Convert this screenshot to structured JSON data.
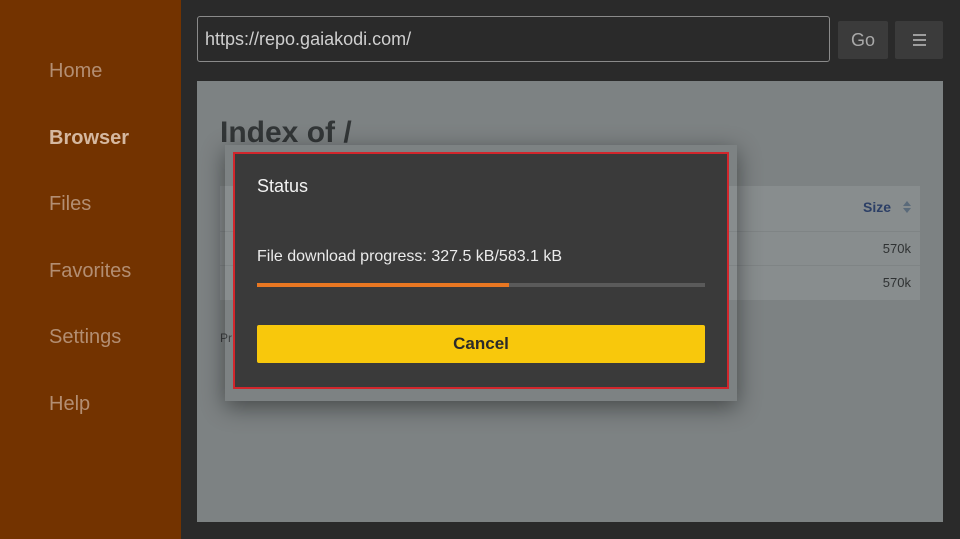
{
  "sidebar": {
    "items": [
      {
        "label": "Home",
        "active": false
      },
      {
        "label": "Browser",
        "active": true
      },
      {
        "label": "Files",
        "active": false
      },
      {
        "label": "Favorites",
        "active": false
      },
      {
        "label": "Settings",
        "active": false
      },
      {
        "label": "Help",
        "active": false
      }
    ]
  },
  "toolbar": {
    "url": "https://repo.gaiakodi.com/",
    "go_label": "Go",
    "menu_icon": "hamburger-menu-icon"
  },
  "page": {
    "heading": "Index of /",
    "table": {
      "size_header": "Size",
      "rows": [
        {
          "size": "570k"
        },
        {
          "size": "570k"
        }
      ]
    },
    "footer_fragment": "Pr"
  },
  "dialog": {
    "title": "Status",
    "progress_text": "File download progress: 327.5 kB/583.1 kB",
    "progress_fraction": 0.5617,
    "cancel_label": "Cancel"
  },
  "colors": {
    "sidebar_bg": "#733300",
    "accent_orange": "#e87722",
    "cancel_yellow": "#f8c80c",
    "dialog_border": "#d1262c"
  }
}
